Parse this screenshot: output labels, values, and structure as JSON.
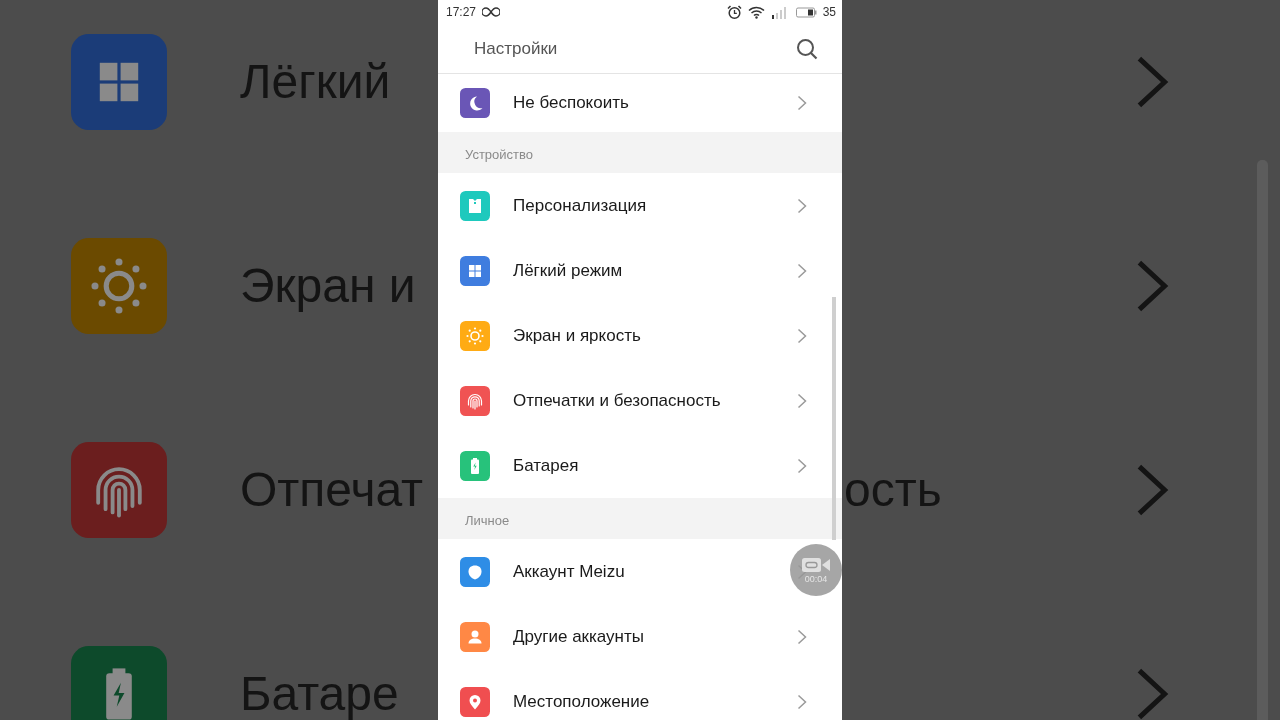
{
  "backdrop": {
    "left_rows": [
      {
        "kind": "grid",
        "color": "#1b3c78",
        "label": "Лёгкий"
      },
      {
        "kind": "sun",
        "color": "#6b4a00",
        "label": "Экран и"
      },
      {
        "kind": "fingerprint",
        "color": "#6b1e1e",
        "label": "Отпечат"
      },
      {
        "kind": "battery",
        "color": "#0d4a2b",
        "label": "Батаре"
      }
    ],
    "right_rows": [
      {
        "chevron": true
      },
      {
        "chevron": true
      },
      {
        "label": "ость",
        "chevron": true
      },
      {
        "chevron": true
      }
    ]
  },
  "status_bar": {
    "time": "17:27",
    "battery": "35"
  },
  "header": {
    "title": "Настройки"
  },
  "sections": [
    {
      "items": [
        {
          "kind": "moon",
          "color": "#6a56b6",
          "label": "Не беспокоить"
        }
      ]
    },
    {
      "title": "Устройство",
      "items": [
        {
          "kind": "card",
          "color": "#1ec9bd",
          "label": "Персонализация"
        },
        {
          "kind": "grid",
          "color": "#3f7ddf",
          "label": "Лёгкий режим"
        },
        {
          "kind": "sun",
          "color": "#ffab14",
          "label": "Экран и яркость"
        },
        {
          "kind": "fingerprint",
          "color": "#f05353",
          "label": "Отпечатки и безопасность"
        },
        {
          "kind": "battery",
          "color": "#27c27b",
          "label": "Батарея"
        }
      ]
    },
    {
      "title": "Личное",
      "items": [
        {
          "kind": "shield",
          "color": "#2e8de6",
          "label": "Аккаунт Meizu"
        },
        {
          "kind": "person",
          "color": "#ff8845",
          "label": "Другие аккаунты"
        },
        {
          "kind": "pin",
          "color": "#f04e50",
          "label": "Местоположение"
        }
      ]
    }
  ],
  "recording": {
    "time": "00:04"
  }
}
